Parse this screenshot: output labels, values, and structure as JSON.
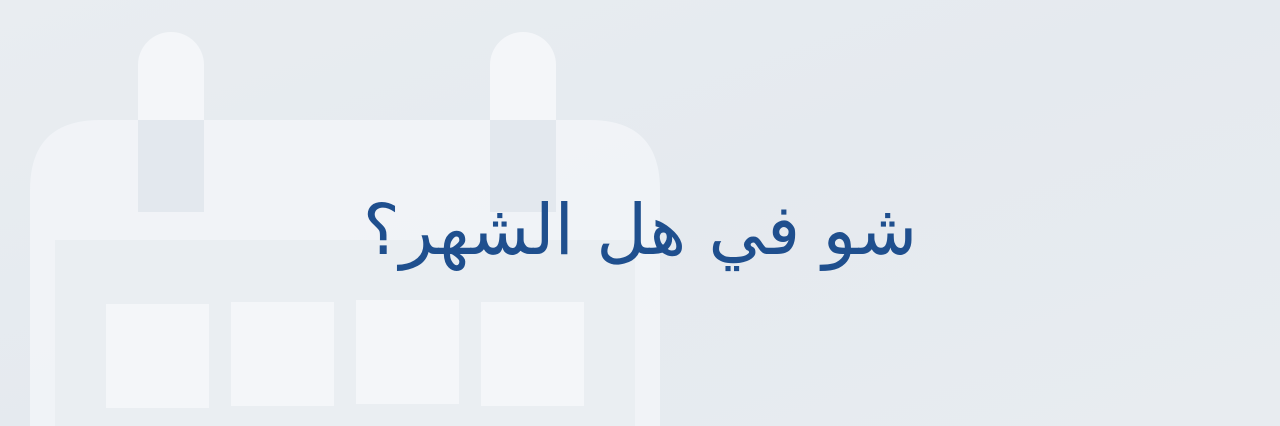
{
  "banner": {
    "headline": "شو في هل الشهر؟",
    "headline_color": "#1f4f8e",
    "background_color": "#e6ebf0",
    "background_icon": "calendar-icon"
  }
}
